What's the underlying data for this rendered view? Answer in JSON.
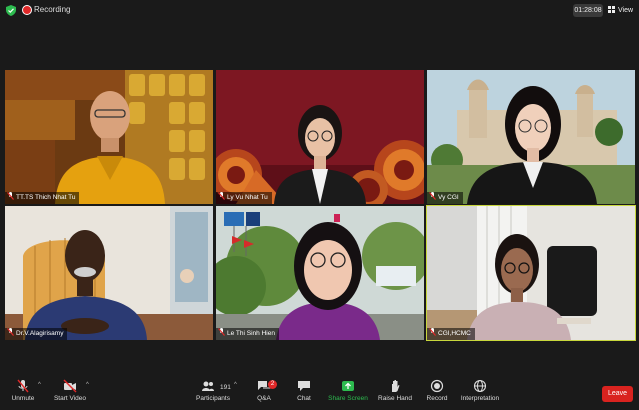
{
  "top_bar": {
    "recording_label": "Recording",
    "meeting_timer": "01:28:08",
    "view_label": "View"
  },
  "participants": [
    {
      "name": "TT.TS Thich Nhat Tu",
      "active_speaker": false
    },
    {
      "name": "Ly Vu Nhat Tu",
      "active_speaker": false
    },
    {
      "name": "Vy CGI",
      "active_speaker": false
    },
    {
      "name": "Dr.V.Alagirisamy",
      "active_speaker": false
    },
    {
      "name": "Le Thi Sinh Hien",
      "active_speaker": false
    },
    {
      "name": "CGI,HCMC",
      "active_speaker": true
    }
  ],
  "toolbar": {
    "unmute": "Unmute",
    "start_video": "Start Video",
    "participants": "Participants",
    "participant_count": "191",
    "qa": "Q&A",
    "qa_badge": "2",
    "chat": "Chat",
    "share_screen": "Share Screen",
    "raise_hand": "Raise Hand",
    "record": "Record",
    "interpretation": "Interpretation",
    "leave": "Leave"
  },
  "colors": {
    "background": "#1a1a1a",
    "active_speaker_border": "#c8d73c",
    "recording_red": "#e02828",
    "share_green": "#2dbb4f",
    "leave_red": "#d9231f"
  }
}
